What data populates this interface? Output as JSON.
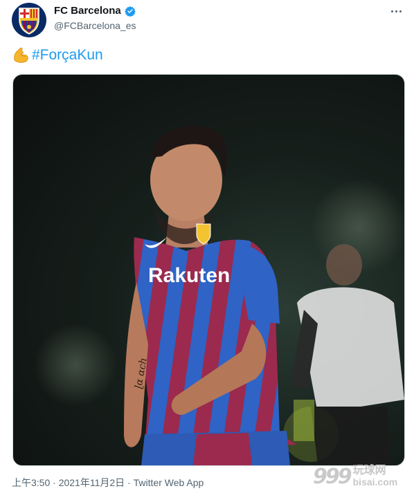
{
  "account": {
    "display_name": "FC Barcelona",
    "handle": "@FCBarcelona_es",
    "verified_icon": "verified-badge-icon",
    "avatar_icon": "fc-barcelona-crest-icon"
  },
  "tweet": {
    "emoji_icon": "flexed-biceps-icon",
    "hashtag": "#ForçaKun"
  },
  "media": {
    "jersey_sponsor": "Rakuten"
  },
  "meta": {
    "time": "上午3:50",
    "separator": " · ",
    "date": "2021年11月2日",
    "source": "Twitter Web App"
  },
  "watermark": {
    "logo": "999",
    "chinese": "玩球网",
    "domain": "bisai.com"
  },
  "colors": {
    "link": "#1d9bf0",
    "verified": "#1d9bf0",
    "secondary_text": "#536471",
    "jersey_blue": "#2f63c6",
    "jersey_red": "#9b2a4e"
  }
}
